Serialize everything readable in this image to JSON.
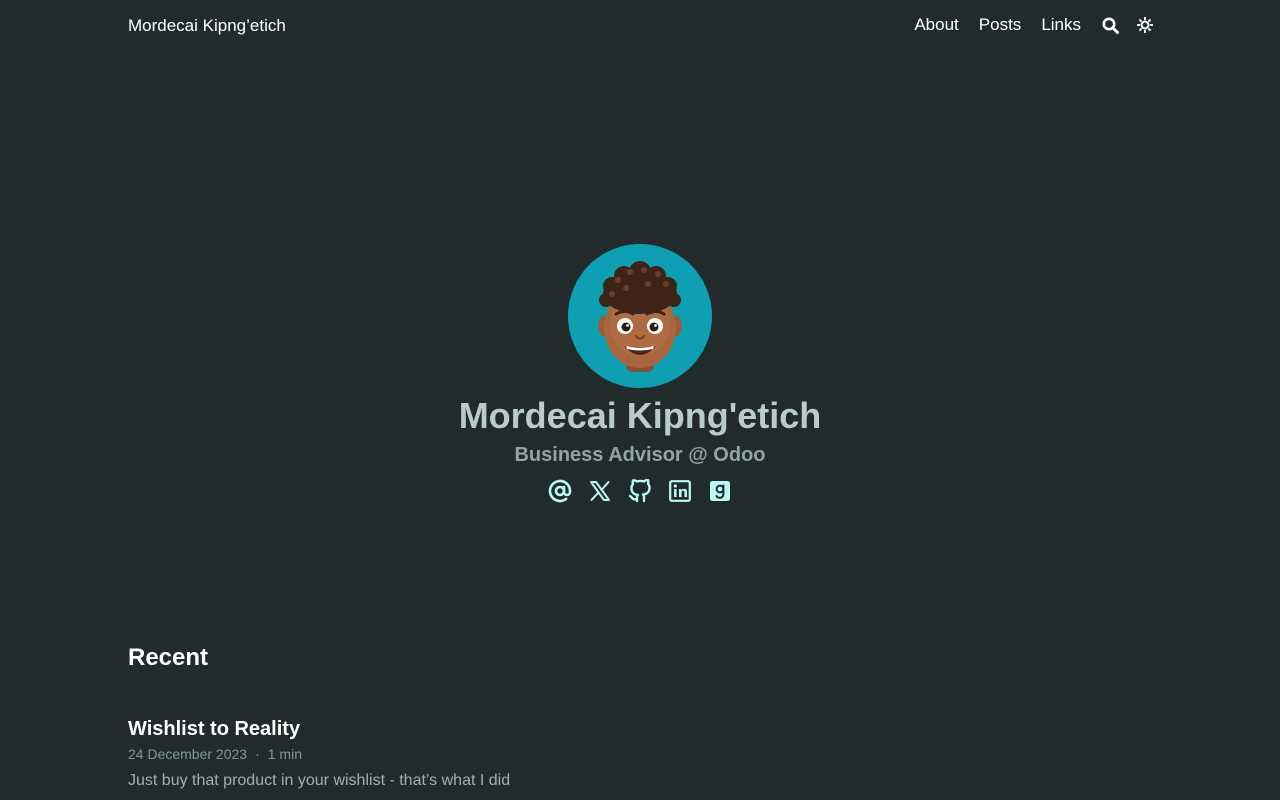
{
  "header": {
    "site_title": "Mordecai Kipng’etich",
    "nav": {
      "about": "About",
      "posts": "Posts",
      "links": "Links"
    },
    "search_icon": "search-icon",
    "theme_icon": "sun-icon"
  },
  "profile": {
    "avatar_icon": "memoji-avatar",
    "name": "Mordecai Kipng'etich",
    "subtitle": "Business Advisor @ Odoo",
    "socials": [
      "at-sign-icon",
      "x-twitter-icon",
      "github-icon",
      "linkedin-icon",
      "goodreads-icon"
    ],
    "colors": {
      "avatar_bg": "#0e9fb3",
      "name": "#b8cdc9",
      "social_icon": "#b9fbf3"
    }
  },
  "recent": {
    "heading": "Recent",
    "posts": [
      {
        "title": "Wishlist to Reality",
        "date": "24 December 2023",
        "separator": "·",
        "read_time": "1 min",
        "summary": "Just buy that product in your wishlist - that’s what I did"
      }
    ]
  },
  "colors": {
    "background": "#212b2b",
    "text": "#ffffff"
  }
}
